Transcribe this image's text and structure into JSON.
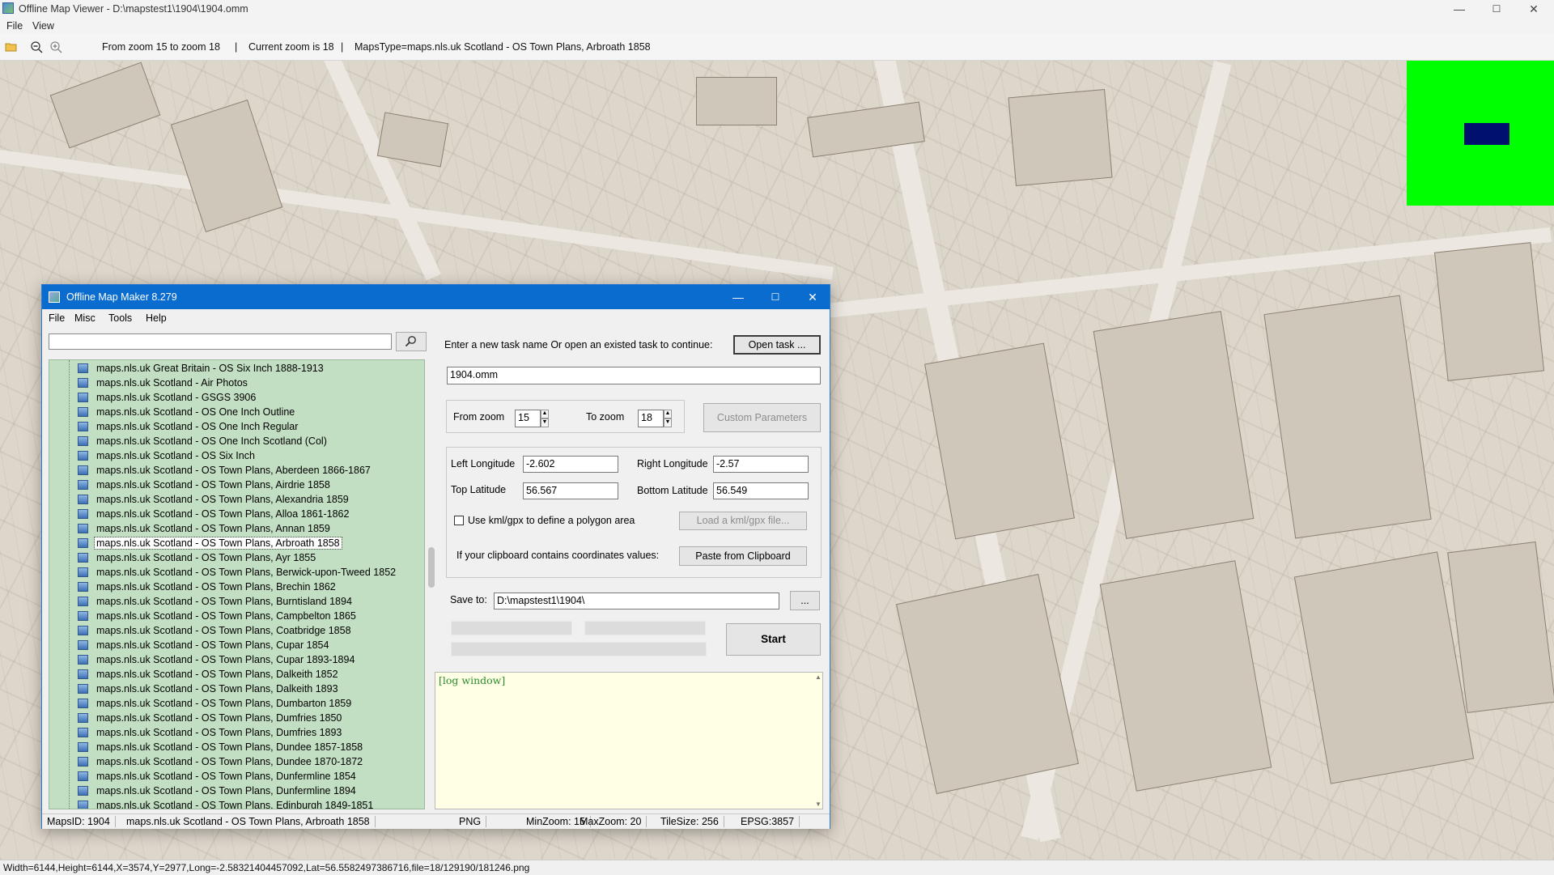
{
  "window": {
    "title": "Offline Map Viewer - D:\\mapstest1\\1904\\1904.omm",
    "menu": [
      "File",
      "View"
    ],
    "controls": {
      "minimize": "—",
      "maximize": "☐",
      "close": "✕"
    }
  },
  "toolbar": {
    "icons": [
      "open-folder-icon",
      "zoom-out-icon",
      "zoom-in-icon"
    ],
    "zoom_range": "From zoom 15 to zoom 18",
    "separator": "|",
    "current_zoom": "Current zoom is 18",
    "maps_type": "MapsType=maps.nls.uk Scotland - OS Town Plans, Arbroath 1858"
  },
  "overview": {
    "bg_color": "#00ff00",
    "viewport_color": "#00106e"
  },
  "status": "Width=6144,Height=6144,X=3574,Y=2977,Long=-2.58321404457092,Lat=56.5582497386716,file=18/129190/181246.png",
  "dialog": {
    "title": "Offline Map Maker 8.279",
    "menu": [
      "File",
      "Misc",
      "Tools",
      "Help"
    ],
    "search_placeholder": "",
    "search_button_icon": "search-icon",
    "map_list": [
      "maps.nls.uk Great Britain - OS Six Inch 1888-1913",
      "maps.nls.uk Scotland - Air Photos",
      "maps.nls.uk Scotland - GSGS 3906",
      "maps.nls.uk Scotland - OS One Inch Outline",
      "maps.nls.uk Scotland - OS One Inch Regular",
      "maps.nls.uk Scotland - OS One Inch Scotland (Col)",
      "maps.nls.uk Scotland - OS Six Inch",
      "maps.nls.uk Scotland - OS Town Plans, Aberdeen 1866-1867",
      "maps.nls.uk Scotland - OS Town Plans, Airdrie 1858",
      "maps.nls.uk Scotland - OS Town Plans, Alexandria 1859",
      "maps.nls.uk Scotland - OS Town Plans, Alloa 1861-1862",
      "maps.nls.uk Scotland - OS Town Plans, Annan 1859",
      "maps.nls.uk Scotland - OS Town Plans, Arbroath 1858",
      "maps.nls.uk Scotland - OS Town Plans, Ayr 1855",
      "maps.nls.uk Scotland - OS Town Plans, Berwick-upon-Tweed 1852",
      "maps.nls.uk Scotland - OS Town Plans, Brechin 1862",
      "maps.nls.uk Scotland - OS Town Plans, Burntisland 1894",
      "maps.nls.uk Scotland - OS Town Plans, Campbelton 1865",
      "maps.nls.uk Scotland - OS Town Plans, Coatbridge 1858",
      "maps.nls.uk Scotland - OS Town Plans, Cupar 1854",
      "maps.nls.uk Scotland - OS Town Plans, Cupar 1893-1894",
      "maps.nls.uk Scotland - OS Town Plans, Dalkeith 1852",
      "maps.nls.uk Scotland - OS Town Plans, Dalkeith 1893",
      "maps.nls.uk Scotland - OS Town Plans, Dumbarton 1859",
      "maps.nls.uk Scotland - OS Town Plans, Dumfries 1850",
      "maps.nls.uk Scotland - OS Town Plans, Dumfries 1893",
      "maps.nls.uk Scotland - OS Town Plans, Dundee 1857-1858",
      "maps.nls.uk Scotland - OS Town Plans, Dundee 1870-1872",
      "maps.nls.uk Scotland - OS Town Plans, Dunfermline 1854",
      "maps.nls.uk Scotland - OS Town Plans, Dunfermline 1894",
      "maps.nls.uk Scotland - OS Town Plans, Edinburgh 1849-1851"
    ],
    "selected_index": 12,
    "task_prompt": "Enter a new task name Or open an existed task to continue:",
    "open_task_label": "Open task ...",
    "task_name": "1904.omm",
    "from_zoom_label": "From zoom",
    "from_zoom": "15",
    "to_zoom_label": "To zoom",
    "to_zoom": "18",
    "custom_params_label": "Custom Parameters",
    "left_lon_label": "Left Longitude",
    "left_lon": "-2.602",
    "right_lon_label": "Right Longitude",
    "right_lon": "-2.57",
    "top_lat_label": "Top Latitude",
    "top_lat": "56.567",
    "bottom_lat_label": "Bottom Latitude",
    "bottom_lat": "56.549",
    "kml_label": "Use kml/gpx to define a polygon area",
    "kml_checked": false,
    "load_kml_label": "Load a kml/gpx file...",
    "clipboard_label": "If your clipboard contains coordinates values:",
    "paste_label": "Paste from Clipboard",
    "save_to_label": "Save to:",
    "save_to": "D:\\mapstest1\\1904\\",
    "browse_label": "...",
    "start_label": "Start",
    "log_text": "[log window]",
    "status": {
      "maps_id": "MapsID: 1904",
      "map_name": "maps.nls.uk Scotland - OS Town Plans, Arbroath 1858",
      "format": "PNG",
      "min_zoom": "MinZoom: 15",
      "max_zoom": "MaxZoom: 20",
      "tile_size": "TileSize: 256",
      "epsg": "EPSG:3857"
    }
  }
}
